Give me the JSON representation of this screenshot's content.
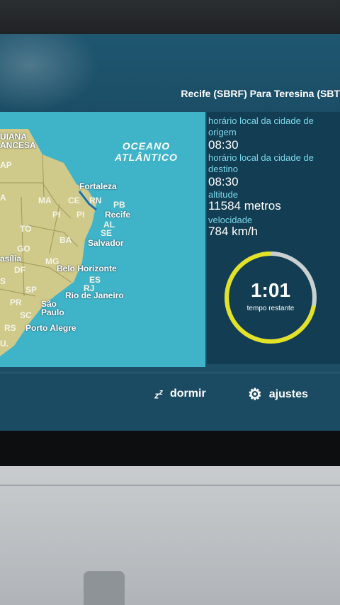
{
  "header": {
    "route": "Recife (SBRF) Para Teresina (SBT"
  },
  "map": {
    "ocean_label_line1": "OCEANO",
    "ocean_label_line2": "ATLÂNTICO",
    "region_top": [
      "UIANA",
      "ANCESA"
    ],
    "cities": {
      "fortaleza": "Fortaleza",
      "recife": "Recife",
      "salvador": "Salvador",
      "belo_horizonte": "Belo Horizonte",
      "rio": "Rio de Janeiro",
      "sao_paulo_1": "São",
      "sao_paulo_2": "Paulo",
      "porto_alegre": "Porto Alegre",
      "brasilia": "asília"
    },
    "states": {
      "ap": "AP",
      "a": "A",
      "ma": "MA",
      "ce": "CE",
      "rn": "RN",
      "pb": "PB",
      "pi": "PI",
      "pe": "PI",
      "al": "AL",
      "se": "SE",
      "to": "TO",
      "ba": "BA",
      "go": "GO",
      "df": "DF",
      "mg": "MG",
      "es": "ES",
      "rj": "RJ",
      "sp": "SP",
      "pr": "PR",
      "sc": "SC",
      "rs": "RS",
      "s": "S",
      "u": "U."
    }
  },
  "info": {
    "origin_time_label_1": "horário local da cidade de",
    "origin_time_label_2": "origem",
    "origin_time": "08:30",
    "dest_time_label_1": "horário local da cidade de",
    "dest_time_label_2": "destino",
    "dest_time": "08:30",
    "altitude_label": "altitude",
    "altitude": "11584 metros",
    "speed_label": "velocidade",
    "speed": "784 km/h",
    "time_remaining": "1:01",
    "time_remaining_label": "tempo restante",
    "progress_fraction": 0.72,
    "ring_color": "#e2e227",
    "ring_track_color": "#c8d0d2"
  },
  "bottom": {
    "sleep_label": "dormir",
    "settings_label": "ajustes"
  }
}
